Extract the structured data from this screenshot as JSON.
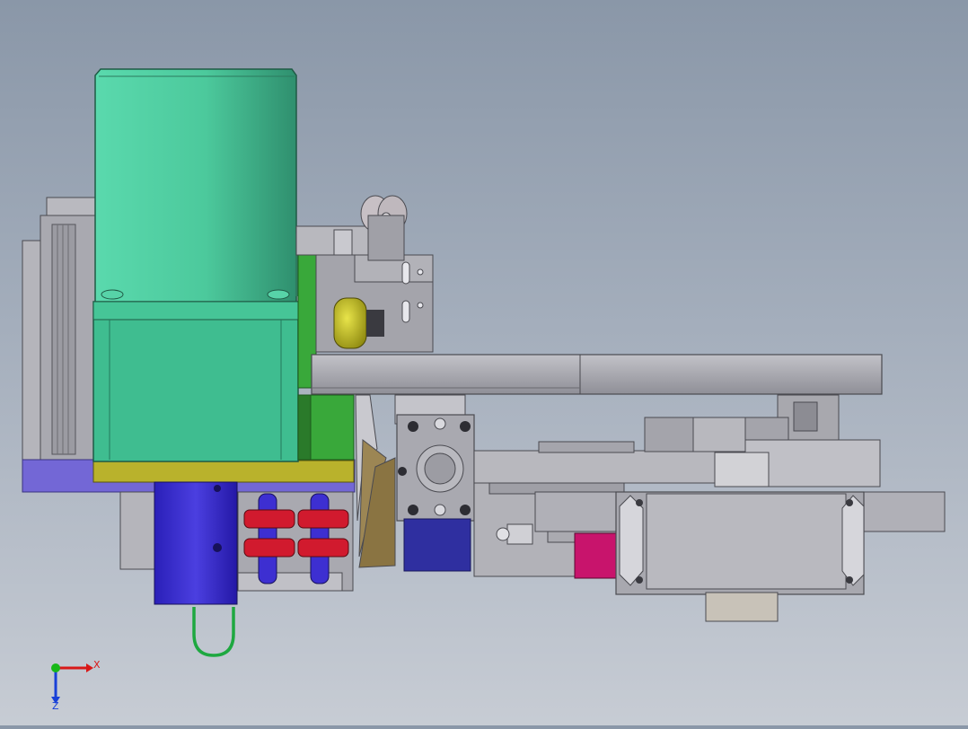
{
  "viewport": {
    "kind": "3D CAD assembly model view",
    "background_colors": [
      "#8a97a8",
      "#a4aebc",
      "#c7ccd4"
    ]
  },
  "model": {
    "colors": {
      "motor_green": "#4fd0a3",
      "motor_base_green": "#3cb88c",
      "steel_gray": "#9a9aa2",
      "light_gray": "#b7b7bd",
      "dark_gray": "#6d6d75",
      "base_purple": "#7367d6",
      "cylinder_blue": "#3d2fd1",
      "navy_blue": "#2f2fa0",
      "clamp_red": "#d11a2e",
      "magenta_block": "#c8146c",
      "olive_yellow": "#b9b22c",
      "roller_yellow": "#d8d41e",
      "bracket_green": "#39a83a",
      "bronze": "#8c7a4a",
      "cable_green": "#1ea840"
    }
  },
  "triad": {
    "x_label": "X",
    "z_label": "Z",
    "x_color": "#d81818",
    "y_color": "#18b818",
    "z_color": "#1840d8"
  }
}
